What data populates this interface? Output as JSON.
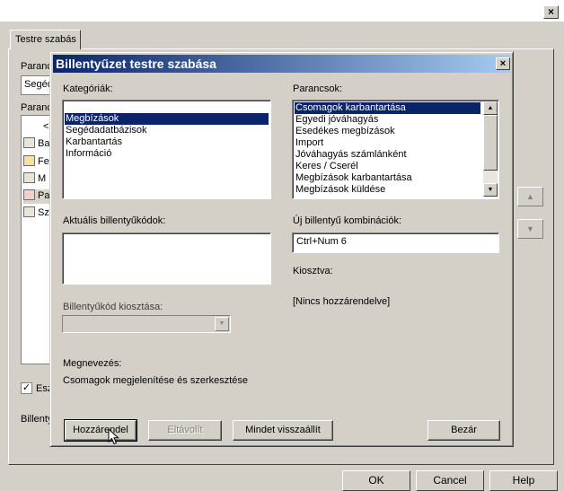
{
  "background_window": {
    "tab_label": "Testre szabás",
    "label_commands_partial": "Paranc",
    "search_value_partial": "Segéd",
    "label_list_partial": "Paranc",
    "list_items": [
      {
        "icon": "bank-icon",
        "text": "Ba"
      },
      {
        "icon": "document-icon",
        "text": "Fe"
      },
      {
        "icon": "building-icon",
        "text": "M"
      },
      {
        "icon": "contact-card-icon",
        "text": "Pa"
      },
      {
        "icon": "bank-icon",
        "text": "Sz"
      }
    ],
    "list_back_arrow": "<",
    "checkbox_label_partial": "Esz",
    "checkbox_checked": true,
    "label_keyboard_partial": "Billenty",
    "buttons": {
      "ok": "OK",
      "cancel": "Cancel",
      "help": "Help"
    },
    "close_glyph": "×"
  },
  "dialog": {
    "title": "Billentyűzet testre szabása",
    "close_glyph": "×",
    "categories_label": "Kategóriák:",
    "categories": [
      "",
      "Megbízások",
      "Segédadatbázisok",
      "Karbantartás",
      "Információ"
    ],
    "categories_selected_index": 1,
    "commands_label": "Parancsok:",
    "commands": [
      "Csomagok karbantartása",
      "Egyedi jóváhagyás",
      "Esedékes megbízások",
      "Import",
      "Jóváhagyás számlánként",
      "Keres / Cserél",
      "Megbízások karbantartása",
      "Megbízások küldése"
    ],
    "commands_selected_index": 0,
    "current_keys_label": "Aktuális billentyűkódok:",
    "new_key_label": "Új billentyű kombinációk:",
    "new_key_value": "Ctrl+Num 6",
    "assigned_to_label": "Kiosztva:",
    "assigned_to_value": "[Nincs hozzárendelve]",
    "assign_key_label": "Billentyűkód kiosztása:",
    "description_label": "Megnevezés:",
    "description_value": "Csomagok megjelenítése és szerkesztése",
    "buttons": {
      "add": "Hozzárendel",
      "remove": "Eltávolít",
      "reset_all": "Mindet visszaállít",
      "close": "Bezár"
    }
  },
  "colors": {
    "title_start": "#0a246a",
    "title_end": "#a6caf0",
    "face": "#d4d0c8",
    "selection": "#0a246a"
  }
}
